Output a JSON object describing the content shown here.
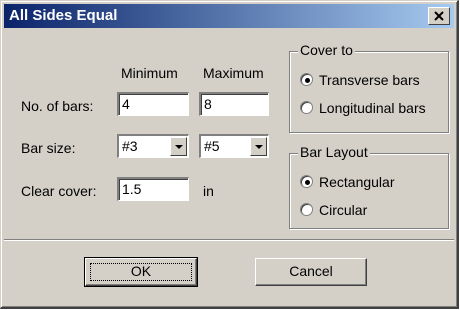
{
  "window": {
    "title": "All Sides Equal"
  },
  "columns": {
    "minimum": "Minimum",
    "maximum": "Maximum"
  },
  "rows": {
    "num_bars": {
      "label": "No. of bars:",
      "min": "4",
      "max": "8"
    },
    "bar_size": {
      "label": "Bar size:",
      "min": "#3",
      "max": "#5"
    },
    "clear_cover": {
      "label": "Clear cover:",
      "value": "1.5",
      "unit": "in"
    }
  },
  "cover_to": {
    "title": "Cover to",
    "options": [
      {
        "label": "Transverse bars",
        "selected": true
      },
      {
        "label": "Longitudinal bars",
        "selected": false
      }
    ]
  },
  "bar_layout": {
    "title": "Bar Layout",
    "options": [
      {
        "label": "Rectangular",
        "selected": true
      },
      {
        "label": "Circular",
        "selected": false
      }
    ]
  },
  "buttons": {
    "ok": "OK",
    "cancel": "Cancel"
  },
  "icons": {
    "close": "close-icon",
    "dropdown": "chevron-down-icon",
    "radio": "radio-dot-icon"
  }
}
